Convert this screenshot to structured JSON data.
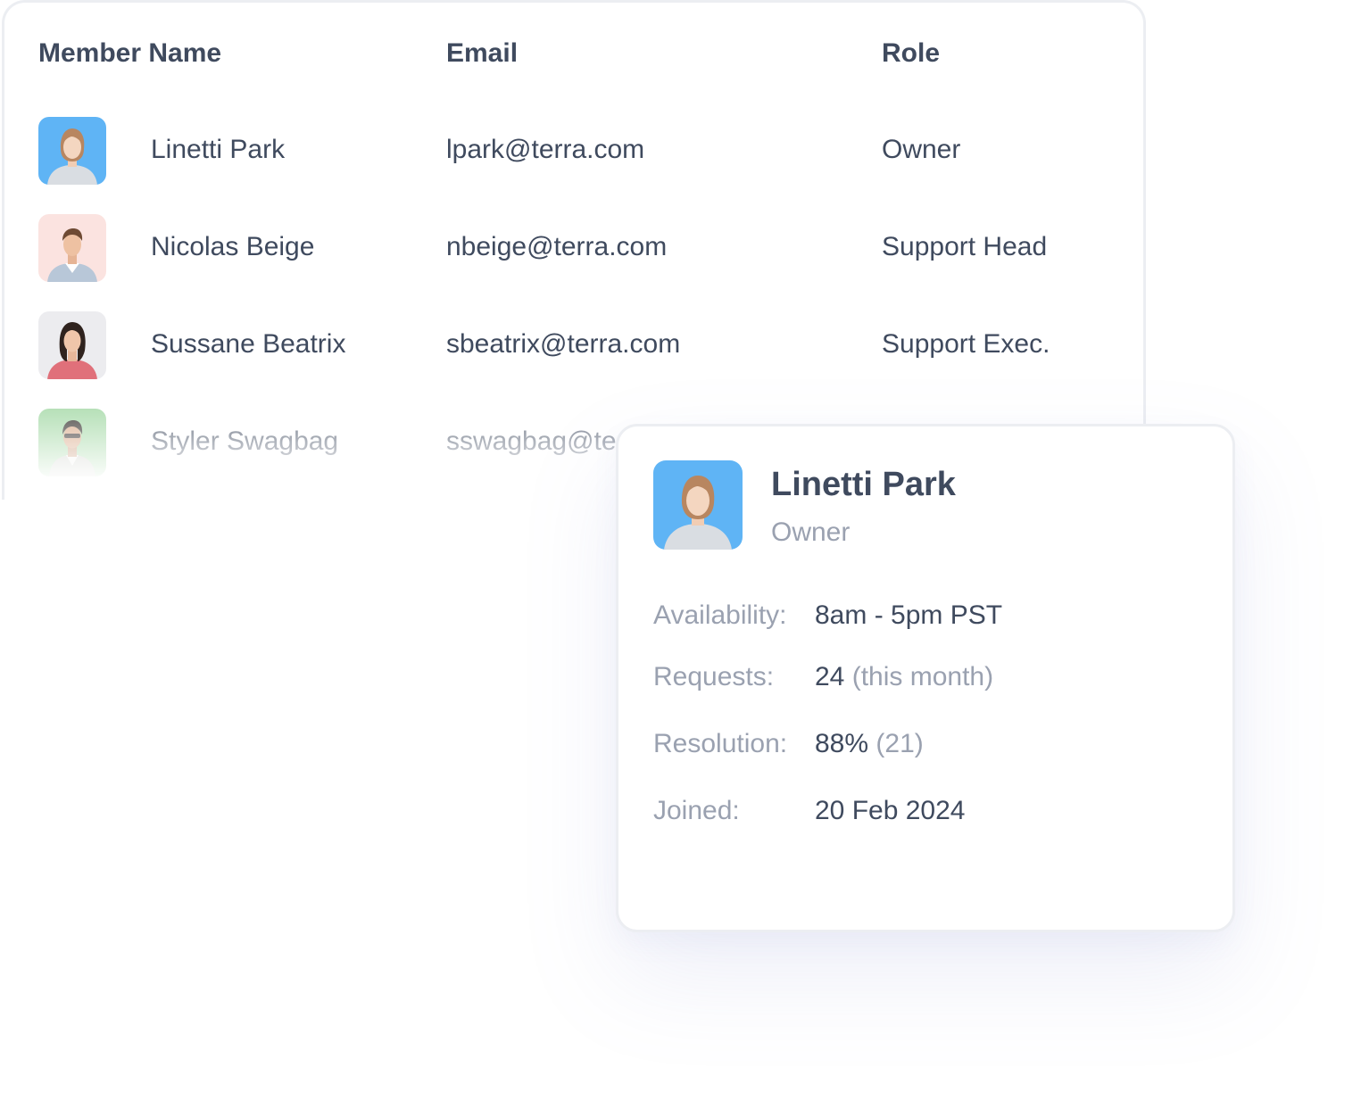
{
  "table": {
    "headers": {
      "name": "Member Name",
      "email": "Email",
      "role": "Role"
    },
    "members": [
      {
        "name": "Linetti Park",
        "email": "lpark@terra.com",
        "role": "Owner",
        "avatar_bg": "#5fb4f5"
      },
      {
        "name": "Nicolas Beige",
        "email": "nbeige@terra.com",
        "role": "Support Head",
        "avatar_bg": "#fbe3e0"
      },
      {
        "name": "Sussane Beatrix",
        "email": "sbeatrix@terra.com",
        "role": "Support Exec.",
        "avatar_bg": "#ececef"
      },
      {
        "name": "Styler Swagbag",
        "email": "sswagbag@te",
        "role": "",
        "avatar_bg": "#9ed6a0"
      }
    ]
  },
  "profile": {
    "name": "Linetti Park",
    "role": "Owner",
    "avatar_bg": "#5fb4f5",
    "stats": {
      "availability": {
        "label": "Availability:",
        "value": "8am - 5pm PST"
      },
      "requests": {
        "label": "Requests:",
        "value": "24",
        "note": "(this month)"
      },
      "resolution": {
        "label": "Resolution:",
        "value": "88%",
        "note": "(21)"
      },
      "joined": {
        "label": "Joined:",
        "value": "20 Feb 2024"
      }
    }
  },
  "colors": {
    "text_primary": "#3f4a5e",
    "text_muted": "#9aa1b0",
    "border": "#eceef2"
  }
}
